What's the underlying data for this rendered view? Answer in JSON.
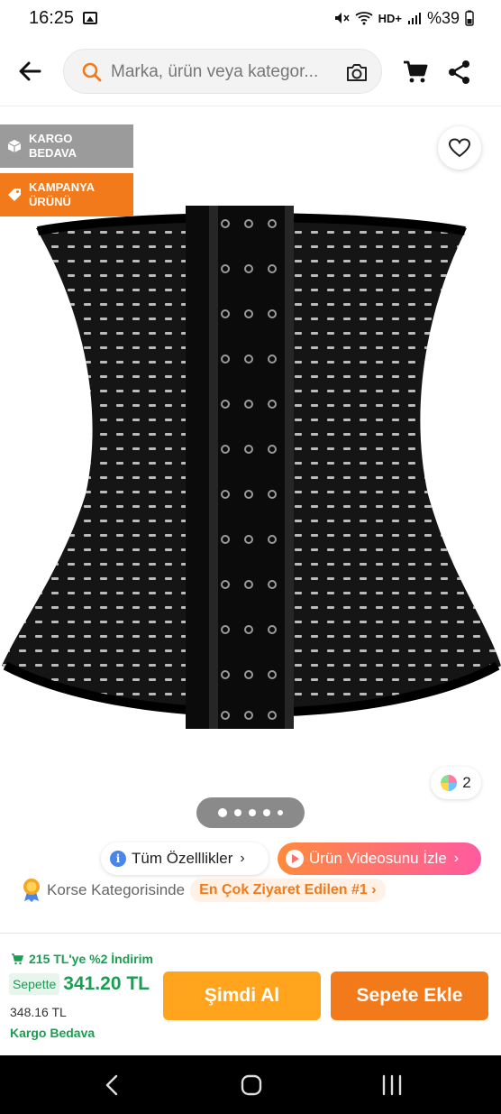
{
  "status_bar": {
    "time": "16:25",
    "battery": "%39"
  },
  "search": {
    "placeholder": "Marka, ürün veya kategor..."
  },
  "badges": {
    "kargo": "KARGO BEDAVA",
    "kampanya": "KAMPANYA ÜRÜNÜ"
  },
  "image": {
    "color_count": "2",
    "pager_dots": 5
  },
  "chips": {
    "features": "Tüm Özelllikler",
    "video": "Ürün Videosunu İzle",
    "rank_prefix": "Korse Kategorisinde",
    "rank_badge": "En Çok Ziyaret Edilen #1"
  },
  "purchase": {
    "discount": "215 TL'ye %2 İndirim",
    "sepette_label": "Sepette",
    "price": "341.20 TL",
    "old_price": "348.16 TL",
    "shipping": "Kargo Bedava",
    "buy_now": "Şimdi Al",
    "add_to_cart": "Sepete Ekle"
  },
  "colors": {
    "brand_orange": "#f27a1a",
    "buy_yellow": "#ffa41c",
    "green": "#1a9e53"
  },
  "icons": [
    "back-arrow-icon",
    "search-icon",
    "camera-icon",
    "cart-icon",
    "share-icon",
    "heart-icon",
    "box-icon",
    "tag-icon",
    "info-icon",
    "play-icon",
    "medal-icon"
  ]
}
